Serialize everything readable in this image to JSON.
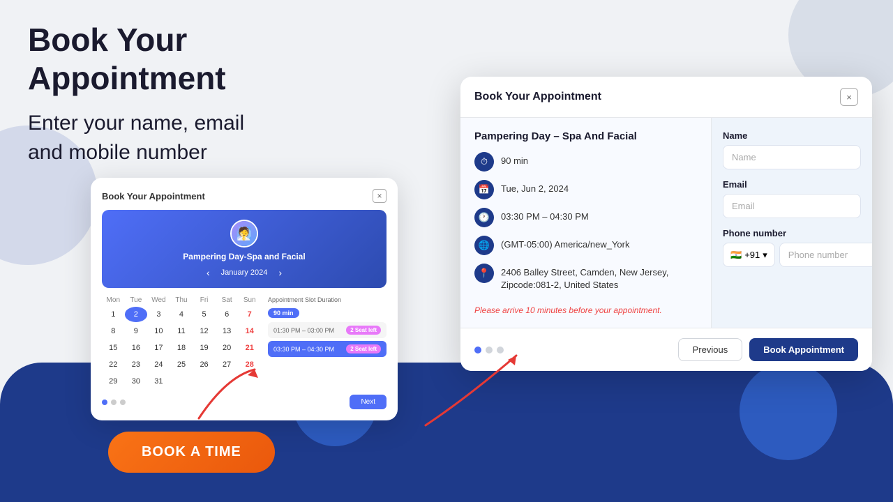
{
  "page": {
    "background_color": "#f0f2f5",
    "title": "Book Your Appointment",
    "subtitle": "Enter your name, email\nand mobile number"
  },
  "book_button": {
    "label": "BOOK A TIME"
  },
  "calendar_widget": {
    "title": "Book Your Appointment",
    "close_label": "×",
    "service_name": "Pampering Day-Spa and Facial",
    "month": "January 2024",
    "day_headers": [
      "Mon",
      "Tue",
      "Wed",
      "Thu",
      "Fri",
      "Sat",
      "Sun"
    ],
    "slot_label": "Appointment Slot Duration",
    "slot_duration": "90 min",
    "slots": [
      {
        "time": "01:30 PM – 03:00 PM",
        "badge": "2 Seat left",
        "active": false
      },
      {
        "time": "03:30 PM – 04:30 PM",
        "badge": "2 Seat left",
        "active": true
      }
    ],
    "nav_prev": "‹",
    "nav_next": "›",
    "next_btn": "Next",
    "dots": 3,
    "active_dot": 0
  },
  "main_modal": {
    "title": "Book Your Appointment",
    "close_label": "×",
    "service_name": "Pampering Day – Spa And Facial",
    "info": {
      "duration": "90 min",
      "date": "Tue, Jun 2, 2024",
      "time": "03:30 PM – 04:30 PM",
      "timezone": "(GMT-05:00) America/new_York",
      "address": "2406 Balley Street, Camden, New Jersey, Zipcode:081-2, United States"
    },
    "notice": "Please arrive 10 minutes before your appointment.",
    "form": {
      "name_label": "Name",
      "name_placeholder": "Name",
      "email_label": "Email",
      "email_placeholder": "Email",
      "phone_label": "Phone number",
      "phone_flag": "🇮🇳",
      "phone_code": "+91",
      "phone_placeholder": "Phone number"
    },
    "footer": {
      "dots": 3,
      "active_dot": 0,
      "previous_label": "Previous",
      "book_label": "Book Appointment"
    }
  }
}
